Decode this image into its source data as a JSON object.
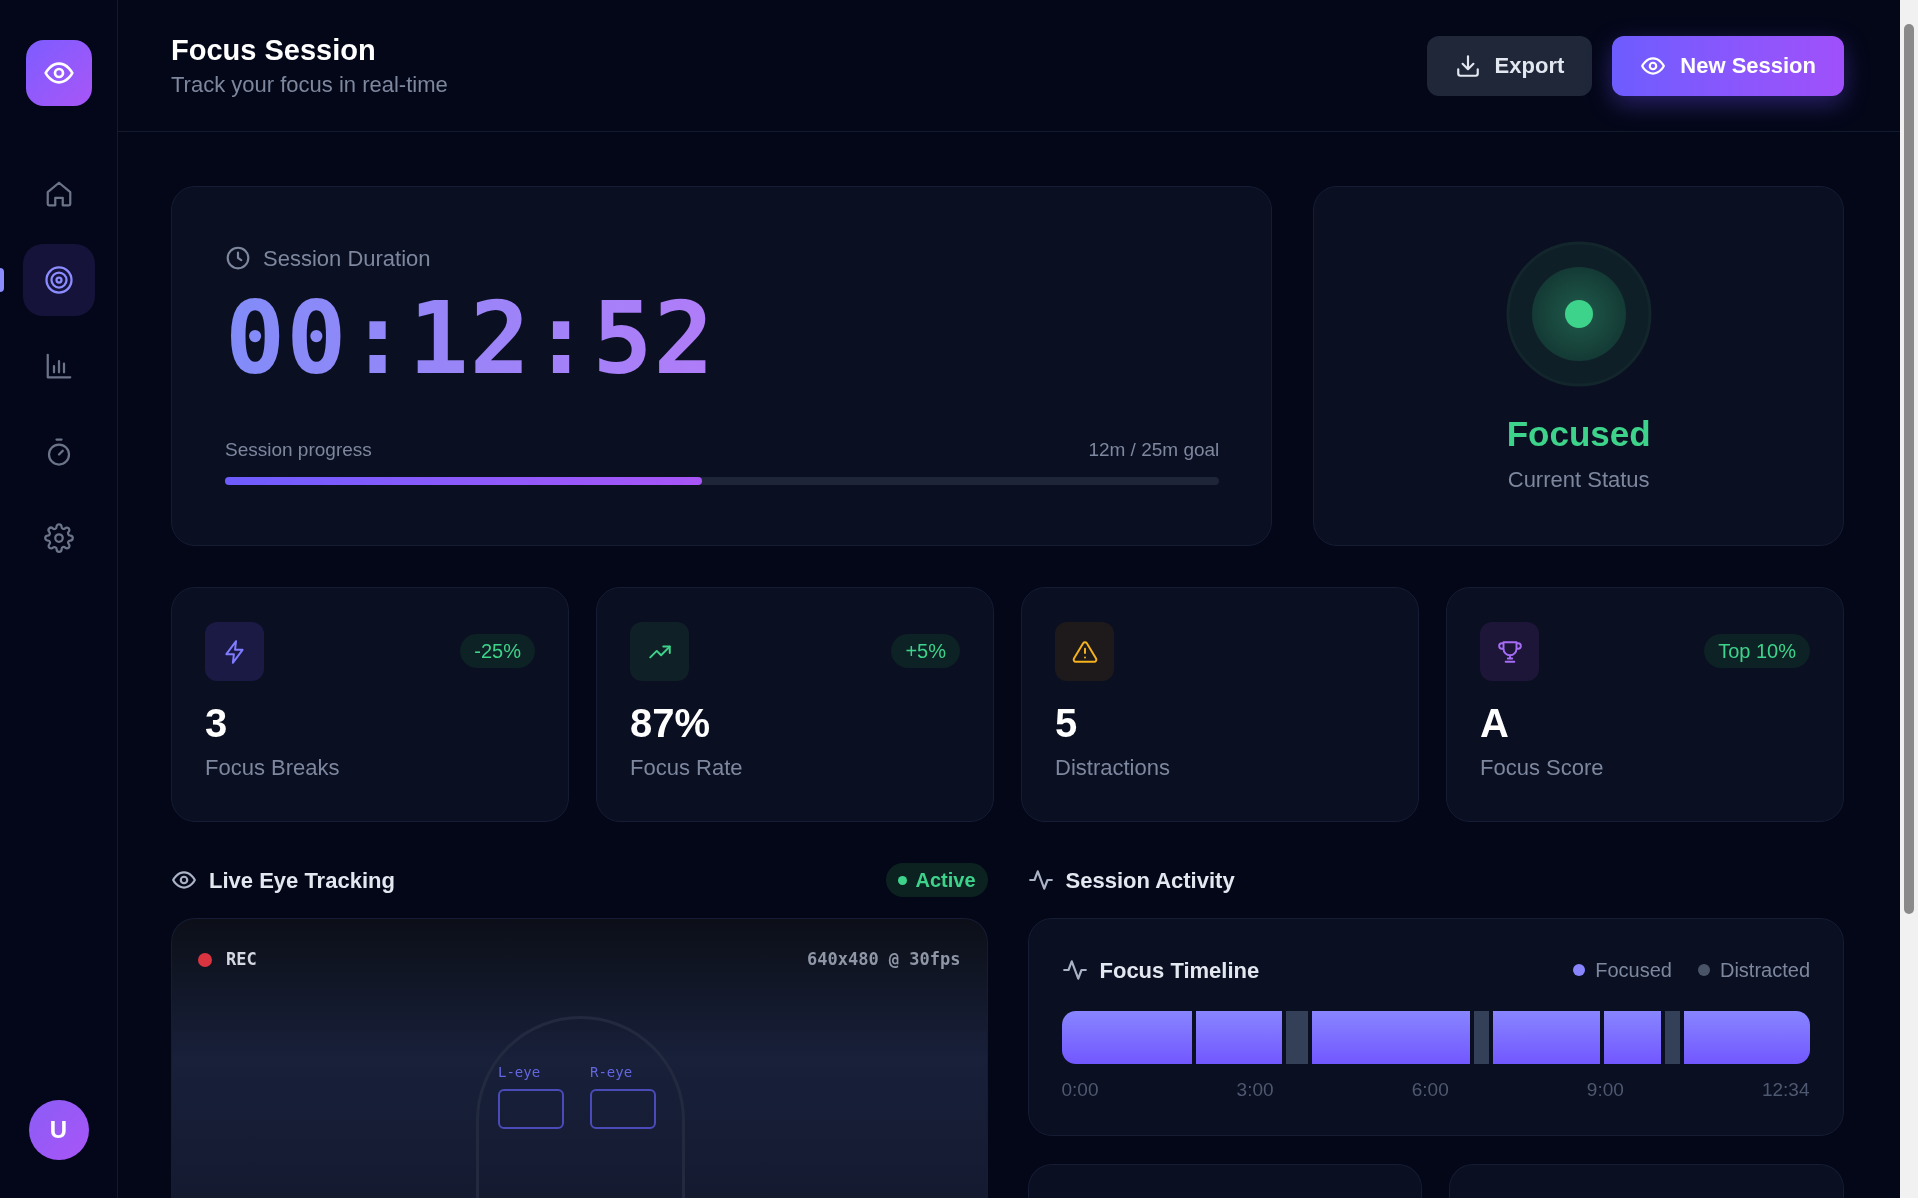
{
  "sidebar": {
    "items": [
      {
        "kind": "home",
        "selected": false
      },
      {
        "kind": "target",
        "selected": true
      },
      {
        "kind": "chart",
        "selected": false
      },
      {
        "kind": "timer",
        "selected": false
      },
      {
        "kind": "settings",
        "selected": false
      }
    ],
    "avatar": "U"
  },
  "header": {
    "title": "Focus Session",
    "subtitle": "Track your focus in real-time",
    "buttons": [
      {
        "label": "Export",
        "kind": "secondary"
      },
      {
        "label": "New Session",
        "kind": "primary"
      }
    ]
  },
  "session": {
    "label": "Session Duration",
    "time": "00:12:52",
    "progress_label": "Session progress",
    "goal": "12m / 25m goal",
    "level": 0.48
  },
  "status": {
    "label": "Focused",
    "caption": "Current Status"
  },
  "stats": [
    {
      "kind": "bolt",
      "value": "3",
      "label": "Focus Breaks",
      "badge": "-25%"
    },
    {
      "kind": "trend",
      "value": "87%",
      "label": "Focus Rate",
      "badge": "+5%"
    },
    {
      "kind": "warning",
      "value": "5",
      "label": "Distractions"
    },
    {
      "kind": "trophy",
      "value": "A",
      "label": "Focus Score",
      "badge": "Top 10%"
    }
  ],
  "eye_tracking": {
    "title": "Live Eye Tracking",
    "status": "Active",
    "rec": "REC",
    "resolution": "640x480 @ 30fps",
    "eyes": [
      "L-eye",
      "R-eye"
    ]
  },
  "activity": {
    "title": "Session Activity",
    "timeline": {
      "title": "Focus Timeline",
      "legend": [
        {
          "label": "Focused",
          "kind": "focused"
        },
        {
          "label": "Distracted",
          "kind": "distracted"
        }
      ],
      "ticks": [
        "0:00",
        "3:00",
        "6:00",
        "9:00",
        "12:34"
      ]
    }
  }
}
